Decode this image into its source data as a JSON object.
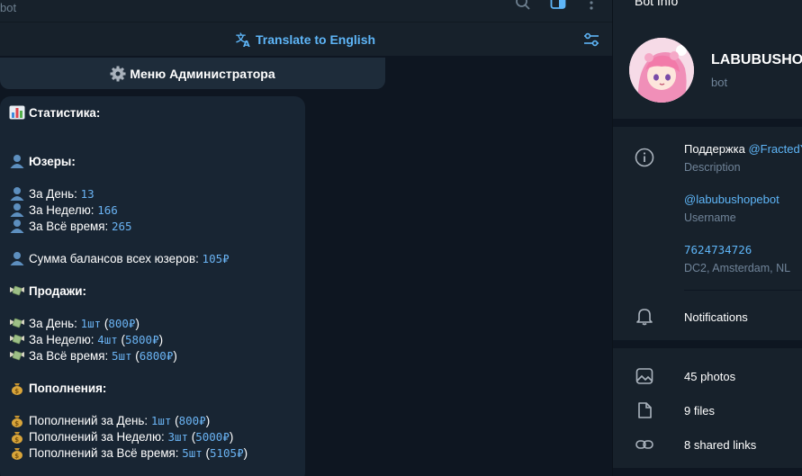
{
  "chat": {
    "header_sub": "bot",
    "translate_label": "Translate to English",
    "admin_button": "Меню Администратора"
  },
  "stats": {
    "title": "Статистика:",
    "users_title": "Юзеры:",
    "users_day_label": "За День: ",
    "users_day_value": "13",
    "users_week_label": "За Неделю: ",
    "users_week_value": "166",
    "users_all_label": "За Всё время: ",
    "users_all_value": "265",
    "balance_label": "Сумма балансов всех юзеров: ",
    "balance_value": "105₽",
    "sales_title": "Продажи:",
    "sales_day_label": "За День: ",
    "sales_day_count": "1шт",
    "sales_day_sum": "800₽",
    "sales_week_label": "За Неделю: ",
    "sales_week_count": "4шт",
    "sales_week_sum": "5800₽",
    "sales_all_label": "За Всё время: ",
    "sales_all_count": "5шт",
    "sales_all_sum": "6800₽",
    "topup_title": "Пополнения:",
    "topup_day_label": "Пополнений за День: ",
    "topup_day_count": "1шт",
    "topup_day_sum": "800₽",
    "topup_week_label": "Пополнений за Неделю: ",
    "topup_week_count": "3шт",
    "topup_week_sum": "5000₽",
    "topup_all_label": "Пополнений за Всё время: ",
    "topup_all_count": "5шт",
    "topup_all_sum": "5105₽",
    "paren_open": " (",
    "paren_close": ")"
  },
  "panel": {
    "title": "Bot Info",
    "bot_name": "LABUBUSHOPE",
    "bot_label": "bot",
    "description_prefix": "Поддержка ",
    "description_link": "@FractedY",
    "description_label": "Description",
    "username": "@labubushopebot",
    "username_label": "Username",
    "bot_id": "7624734726",
    "dc_label": "DC2, Amsterdam, NL",
    "notifications": "Notifications",
    "photos": "45 photos",
    "files": "9 files",
    "links": "8 shared links"
  },
  "colors": {
    "background": "#0e1621",
    "panel": "#17212b",
    "bubble": "#182533",
    "accent": "#5eb5f7",
    "muted": "#708499"
  },
  "icons": [
    "search-icon",
    "sidebar-toggle-icon",
    "more-icon",
    "translate-icon",
    "settings-sliders-icon",
    "gear-icon",
    "chart-icon",
    "user-icon",
    "money-wings-icon",
    "money-bag-icon",
    "info-icon",
    "bell-icon",
    "photo-icon",
    "file-icon",
    "link-icon"
  ]
}
